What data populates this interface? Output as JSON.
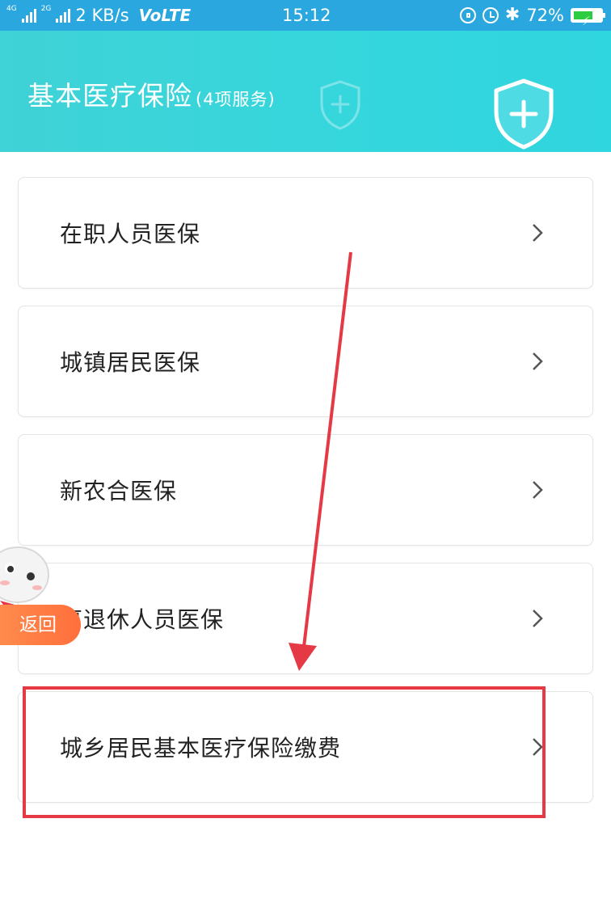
{
  "status_bar": {
    "net_label_1": "4G",
    "net_label_2": "2G",
    "speed": "2 KB/s",
    "volte": "VoLTE",
    "time": "15:12",
    "battery_percent": "72%",
    "battery_level": 0.72
  },
  "header": {
    "title": "基本医疗保险",
    "subtitle": "(4项服务)"
  },
  "services": [
    {
      "label": "在职人员医保"
    },
    {
      "label": "城镇居民医保"
    },
    {
      "label": "新农合医保"
    },
    {
      "label": "离退休人员医保"
    },
    {
      "label": "城乡居民基本医疗保险缴费"
    }
  ],
  "float": {
    "back_label": "返回"
  },
  "colors": {
    "status_bg": "#29a7de",
    "header_bg": "#36d6dc",
    "highlight": "#e63946",
    "back_button": "#ff7a45"
  }
}
